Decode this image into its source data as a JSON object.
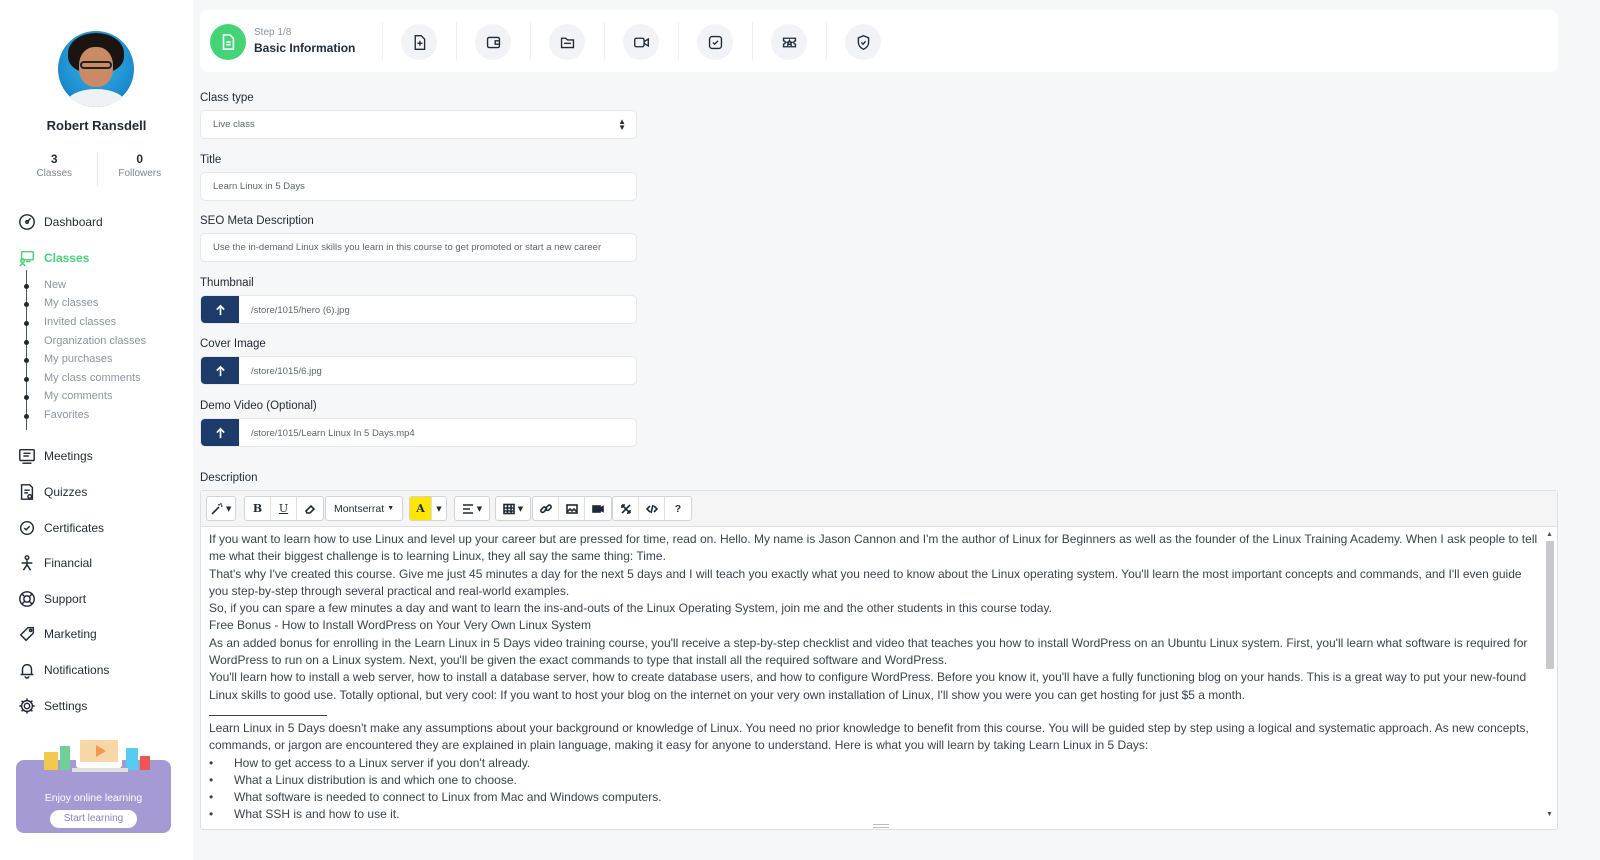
{
  "user": {
    "name": "Robert Ransdell",
    "classes_count": "3",
    "classes_label": "Classes",
    "followers_count": "0",
    "followers_label": "Followers"
  },
  "nav": {
    "dashboard": "Dashboard",
    "classes": "Classes",
    "classes_sub": [
      "New",
      "My classes",
      "Invited classes",
      "Organization classes",
      "My purchases",
      "My class comments",
      "My comments",
      "Favorites"
    ],
    "meetings": "Meetings",
    "quizzes": "Quizzes",
    "certificates": "Certificates",
    "financial": "Financial",
    "support": "Support",
    "marketing": "Marketing",
    "notifications": "Notifications",
    "settings": "Settings"
  },
  "promo": {
    "text": "Enjoy online learning",
    "button": "Start learning"
  },
  "steps": {
    "current": "Step 1/8",
    "title": "Basic Information"
  },
  "form": {
    "class_type_label": "Class type",
    "class_type_value": "Live class",
    "title_label": "Title",
    "title_value": "Learn Linux in 5 Days",
    "seo_label": "SEO Meta Description",
    "seo_value": "Use the in-demand Linux skills you learn in this course to get promoted or start a new career",
    "thumbnail_label": "Thumbnail",
    "thumbnail_value": "/store/1015/hero (6).jpg",
    "cover_label": "Cover Image",
    "cover_value": "/store/1015/6.jpg",
    "video_label": "Demo Video (Optional)",
    "video_value": "/store/1015/Learn Linux In 5 Days.mp4",
    "description_label": "Description"
  },
  "toolbar": {
    "font": "Montserrat",
    "bold": "B",
    "underline": "U",
    "color": "A",
    "help": "?"
  },
  "description": {
    "paragraphs": [
      "If you want to learn how to use Linux and level up your career but are pressed for time, read on. Hello. My name is Jason Cannon and I'm the author of Linux for Beginners as well as the founder of the Linux Training Academy. When I ask people to tell me what their biggest challenge is to learning Linux, they all say the same thing: Time.",
      "That's why I've created this course. Give me just 45 minutes a day for the next 5 days and I will teach you exactly what you need to know about the Linux operating system. You'll learn the most important concepts and commands, and I'll even guide you step-by-step through several practical and real-world examples.",
      "So, if you can spare a few minutes a day and want to learn the ins-and-outs of the Linux Operating System, join me and the other students in this course today.",
      "Free Bonus - How to Install WordPress on Your Very Own Linux System",
      "As an added bonus for enrolling in the Learn Linux in 5 Days video training course, you'll receive a step-by-step checklist and video that teaches you how to install WordPress on an Ubuntu Linux system. First, you'll learn what software is required for WordPress to run on a Linux system. Next, you'll be given the exact commands to type that install all the required software and WordPress.",
      "You'll learn how to install a web server, how to install a database server, how to create database users, and how to configure WordPress. Before you know it, you'll have a fully functioning blog on your hands. This is a great way to put your new-found Linux skills to good use. Totally optional, but very cool: If you want to host your blog on the internet on your very own installation of Linux, I'll show you were you can get hosting for just $5 a month."
    ],
    "after_rule": "Learn Linux in 5 Days doesn't make any assumptions about your background or knowledge of Linux. You need no prior knowledge to benefit from this course. You will be guided step by step using a logical and systematic approach. As new concepts, commands, or jargon are encountered they are explained in plain language, making it easy for anyone to understand. Here is what you will learn by taking Learn Linux in 5 Days:",
    "bullet_char": "•",
    "bullets": [
      "How to get access to a Linux server if you don't already.",
      "What a Linux distribution is and which one to choose.",
      "What software is needed to connect to Linux from Mac and Windows computers.",
      "What SSH is and how to use it."
    ]
  },
  "colors": {
    "accent": "#43d477",
    "upload_btn": "#1d3b6a",
    "promo": "#a69ad4"
  }
}
